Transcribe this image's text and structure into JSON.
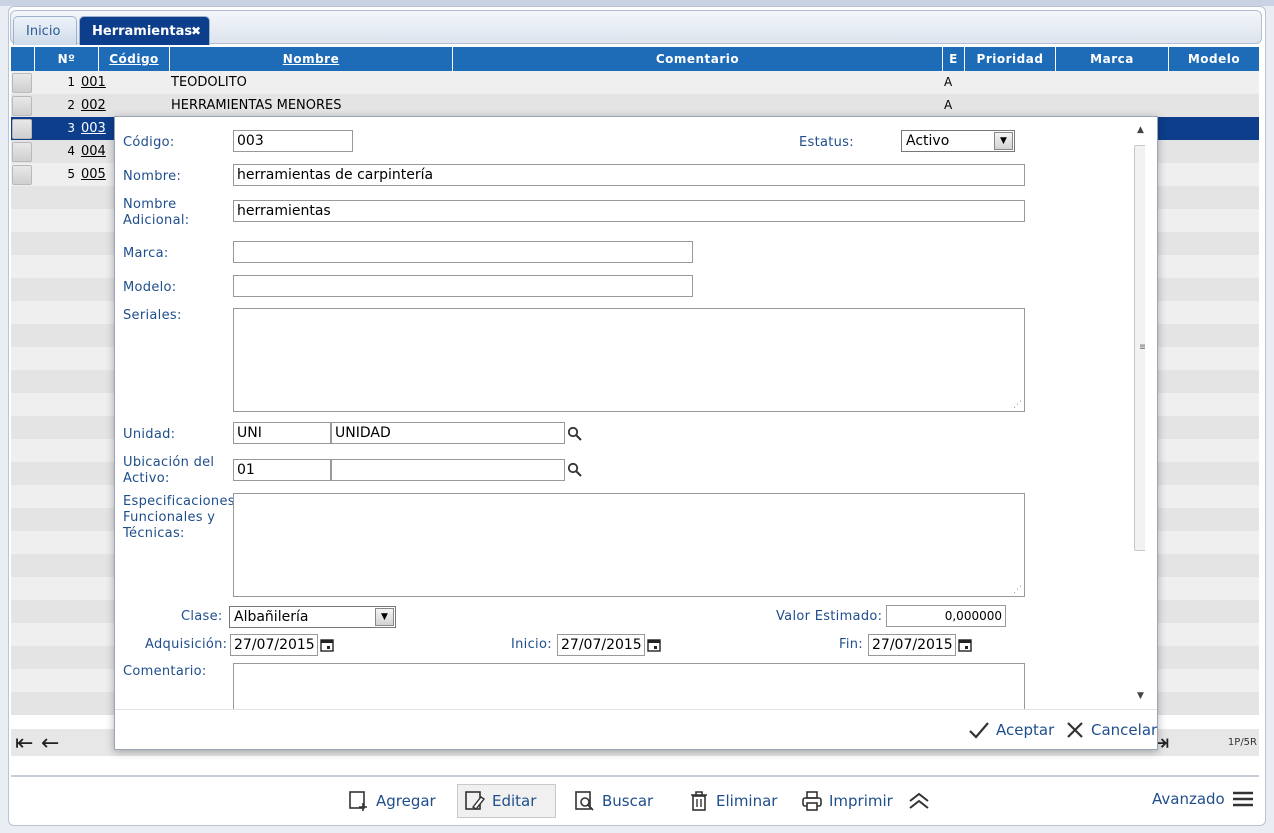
{
  "tabs": [
    {
      "label": "Inicio"
    },
    {
      "label": "Herramientas",
      "close": "✖"
    }
  ],
  "grid": {
    "headers": {
      "num": "Nº",
      "codigo": "Código",
      "nombre": "Nombre",
      "comentario": "Comentario",
      "e": "E",
      "prioridad": "Prioridad",
      "marca": "Marca",
      "modelo": "Modelo"
    },
    "rows": [
      {
        "n": "1",
        "codigo": "001",
        "nombre": "TEODOLITO",
        "e": "A"
      },
      {
        "n": "2",
        "codigo": "002",
        "nombre": "HERRAMIENTAS MENORES",
        "e": "A"
      },
      {
        "n": "3",
        "codigo": "003",
        "nombre": "",
        "e": ""
      },
      {
        "n": "4",
        "codigo": "004",
        "nombre": "",
        "e": ""
      },
      {
        "n": "5",
        "codigo": "005",
        "nombre": "",
        "e": ""
      }
    ],
    "page_info": "1P/5R"
  },
  "form": {
    "codigo_label": "Código:",
    "codigo_value": "003",
    "estatus_label": "Estatus:",
    "estatus_value": "Activo",
    "nombre_label": "Nombre:",
    "nombre_value": "herramientas de carpintería",
    "nombre_adicional_label_1": "Nombre",
    "nombre_adicional_label_2": "Adicional:",
    "nombre_adicional_value": "herramientas",
    "marca_label": "Marca:",
    "marca_value": "",
    "modelo_label": "Modelo:",
    "modelo_value": "",
    "seriales_label": "Seriales:",
    "unidad_label": "Unidad:",
    "unidad_code": "UNI",
    "unidad_desc": "UNIDAD",
    "ubicacion_label_1": "Ubicación del",
    "ubicacion_label_2": "Activo:",
    "ubicacion_code": "01",
    "ubicacion_desc": "",
    "especificaciones_label_1": "Especificaciones",
    "especificaciones_label_2": "Funcionales y",
    "especificaciones_label_3": "Técnicas:",
    "clase_label": "Clase:",
    "clase_value": "Albañilería",
    "valor_label": "Valor Estimado:",
    "valor_value": "0,000000",
    "adquisicion_label": "Adquisición:",
    "adquisicion_value": "27/07/2015",
    "inicio_label": "Inicio:",
    "inicio_value": "27/07/2015",
    "fin_label": "Fin:",
    "fin_value": "27/07/2015",
    "comentario_label": "Comentario:"
  },
  "dialog_buttons": {
    "aceptar": "Aceptar",
    "cancelar": "Cancelar"
  },
  "toolbar": {
    "agregar": "Agregar",
    "editar": "Editar",
    "buscar": "Buscar",
    "eliminar": "Eliminar",
    "imprimir": "Imprimir",
    "avanzado": "Avanzado"
  },
  "colors": {
    "header_blue": "#1e6bb8",
    "selected_row": "#0d3e8c",
    "label_blue": "#1f4e8c"
  }
}
